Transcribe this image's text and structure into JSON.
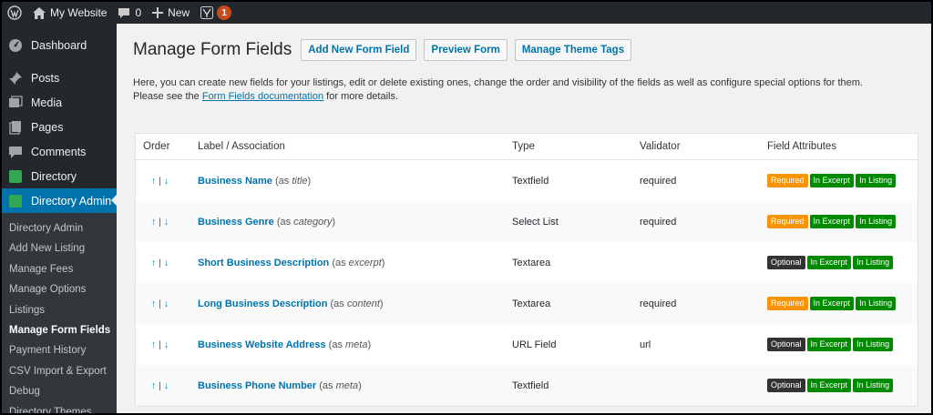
{
  "adminbar": {
    "site_name": "My Website",
    "comments_count": "0",
    "new_label": "New",
    "notification_count": "1"
  },
  "sidebar": {
    "items": [
      {
        "label": "Dashboard",
        "icon": "dashboard-icon"
      },
      {
        "label": "Posts",
        "icon": "pin-icon"
      },
      {
        "label": "Media",
        "icon": "media-icon"
      },
      {
        "label": "Pages",
        "icon": "pages-icon"
      },
      {
        "label": "Comments",
        "icon": "comment-icon"
      },
      {
        "label": "Directory",
        "icon": "directory-icon"
      },
      {
        "label": "Directory Admin",
        "icon": "directory-admin-icon"
      }
    ],
    "submenu": [
      "Directory Admin",
      "Add New Listing",
      "Manage Fees",
      "Manage Options",
      "Listings",
      "Manage Form Fields",
      "Payment History",
      "CSV Import & Export",
      "Debug",
      "Directory Themes"
    ],
    "active_submenu": "Manage Form Fields"
  },
  "page": {
    "title": "Manage Form Fields",
    "buttons": [
      "Add New Form Field",
      "Preview Form",
      "Manage Theme Tags"
    ],
    "intro_line1": "Here, you can create new fields for your listings, edit or delete existing ones, change the order and visibility of the fields as well as configure special options for them.",
    "intro_line2_pre": "Please see the ",
    "intro_link": "Form Fields documentation",
    "intro_line2_post": " for more details."
  },
  "table": {
    "headers": [
      "Order",
      "Label / Association",
      "Type",
      "Validator",
      "Field Attributes"
    ],
    "order_glyph": "↑ | ↓",
    "rows": [
      {
        "name": "Business Name",
        "assoc": "title",
        "type": "Textfield",
        "validator": "required",
        "attrs": [
          "Required",
          "In Excerpt",
          "In Listing"
        ]
      },
      {
        "name": "Business Genre",
        "assoc": "category",
        "type": "Select List",
        "validator": "required",
        "attrs": [
          "Required",
          "In Excerpt",
          "In Listing"
        ]
      },
      {
        "name": "Short Business Description",
        "assoc": "excerpt",
        "type": "Textarea",
        "validator": "",
        "attrs": [
          "Optional",
          "In Excerpt",
          "In Listing"
        ]
      },
      {
        "name": "Long Business Description",
        "assoc": "content",
        "type": "Textarea",
        "validator": "required",
        "attrs": [
          "Required",
          "In Excerpt",
          "In Listing"
        ]
      },
      {
        "name": "Business Website Address",
        "assoc": "meta",
        "type": "URL Field",
        "validator": "url",
        "attrs": [
          "Optional",
          "In Excerpt",
          "In Listing"
        ]
      },
      {
        "name": "Business Phone Number",
        "assoc": "meta",
        "type": "Textfield",
        "validator": "",
        "attrs": [
          "Optional",
          "In Excerpt",
          "In Listing"
        ]
      }
    ]
  },
  "colors": {
    "accent": "#0073aa",
    "required": "#f89406",
    "optional": "#333333",
    "in_tag": "#008a00"
  }
}
